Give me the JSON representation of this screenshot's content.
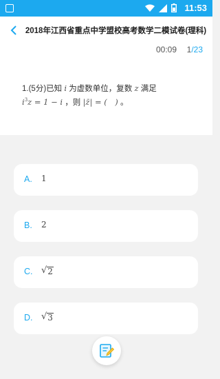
{
  "status_bar": {
    "time": "11:53",
    "background": "#1ca9ef",
    "icons": [
      "wifi-icon",
      "signal-icon",
      "battery-icon"
    ]
  },
  "header": {
    "title": "2018年江西省重点中学盟校高考数学二模试卷(理科)",
    "back_icon": "chevron-left-icon"
  },
  "progress": {
    "timer": "00:09",
    "current": "1",
    "total": "/23",
    "accent": "#1ca9ef"
  },
  "question": {
    "prefix": "1.(5分)已知",
    "var_i": "i",
    "mid1": "为虚数单位，复数",
    "var_z": "z",
    "mid2": "满足",
    "eq_base": "i",
    "eq_exp": "3",
    "eq_rest": "z = 1 − i",
    "mid3": "，则",
    "abs_expr": "|z̄| = (　)",
    "end": "。"
  },
  "options": [
    {
      "letter": "A.",
      "value": "1"
    },
    {
      "letter": "B.",
      "value": "2"
    },
    {
      "letter": "C.",
      "radical": "√",
      "radicand": "2"
    },
    {
      "letter": "D.",
      "radical": "√",
      "radicand": "3"
    }
  ],
  "fab": {
    "icon": "answer-sheet-edit-icon"
  }
}
